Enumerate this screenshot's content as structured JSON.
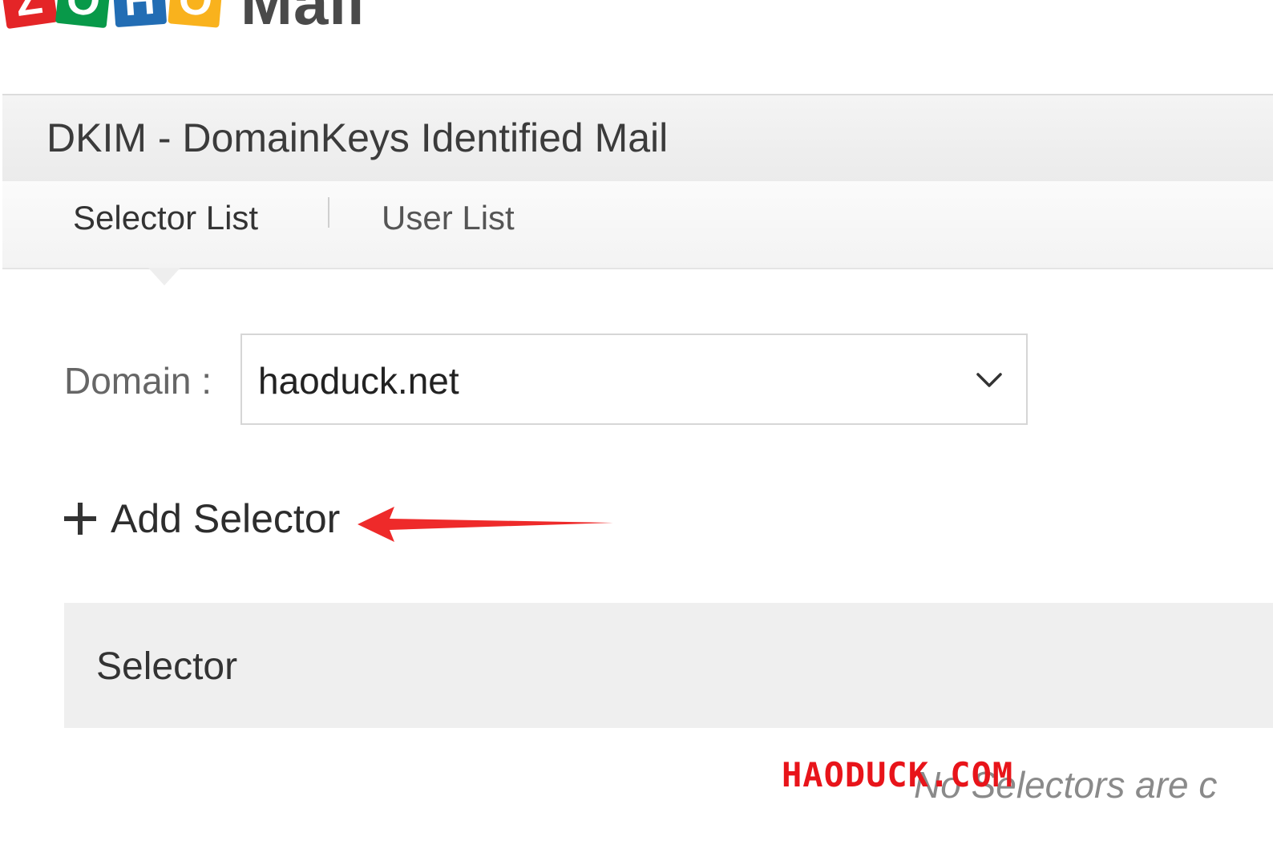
{
  "logo": {
    "letters": [
      "Z",
      "O",
      "H",
      "O"
    ],
    "product": "Mail",
    "colors": [
      "#e42527",
      "#089949",
      "#226db4",
      "#f9b21d"
    ]
  },
  "header": {
    "title": "DKIM - DomainKeys Identified Mail"
  },
  "tabs": [
    {
      "label": "Selector List",
      "active": true
    },
    {
      "label": "User List",
      "active": false
    }
  ],
  "domain": {
    "label": "Domain :",
    "value": "haoduck.net",
    "icon": "chevron-down-icon"
  },
  "actions": {
    "add_selector": "Add Selector",
    "icon": "plus-icon"
  },
  "table": {
    "columns": [
      "Selector"
    ]
  },
  "empty_message": "No Selectors are c",
  "watermark": "HAODUCK.COM",
  "annotation_color": "#e8141a"
}
